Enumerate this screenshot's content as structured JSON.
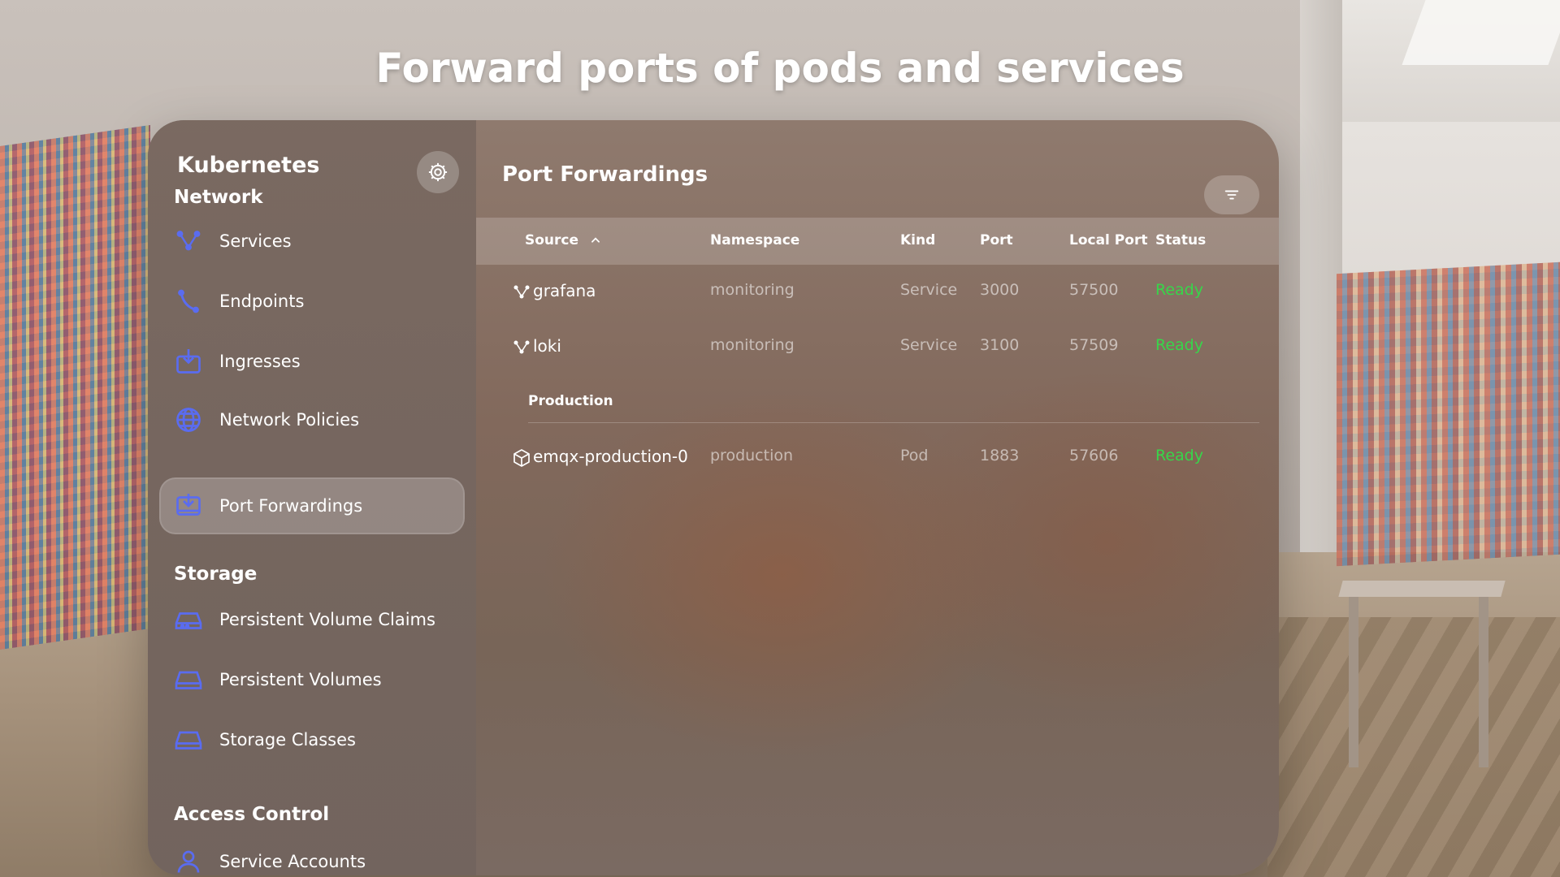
{
  "headline": "Forward ports of pods and services",
  "sidebar": {
    "title": "Kubernetes",
    "settings_icon": "gear-icon",
    "sections": {
      "network": "Network",
      "storage": "Storage",
      "access_control": "Access Control"
    },
    "items": [
      {
        "label": "Services",
        "icon": "services-icon"
      },
      {
        "label": "Endpoints",
        "icon": "endpoints-icon"
      },
      {
        "label": "Ingresses",
        "icon": "ingresses-icon"
      },
      {
        "label": "Network Policies",
        "icon": "globe-icon"
      },
      {
        "label": "Port Forwardings",
        "icon": "port-forward-icon",
        "active": true
      },
      {
        "label": "Persistent Volume Claims",
        "icon": "volume-claim-icon"
      },
      {
        "label": "Persistent Volumes",
        "icon": "drive-icon"
      },
      {
        "label": "Storage Classes",
        "icon": "drive-icon"
      },
      {
        "label": "Service Accounts",
        "icon": "person-icon"
      }
    ]
  },
  "main": {
    "title": "Port Forwardings",
    "filter_icon": "filter-icon",
    "columns": {
      "source": "Source",
      "namespace": "Namespace",
      "kind": "Kind",
      "port": "Port",
      "local_port": "Local Port",
      "status": "Status"
    },
    "sort": {
      "column": "Source",
      "direction": "ascending",
      "icon": "chevron-up-icon"
    },
    "rows": [
      {
        "source": "grafana",
        "namespace": "monitoring",
        "kind": "Service",
        "port": "3000",
        "local_port": "57500",
        "status": "Ready",
        "icon": "service-icon"
      },
      {
        "source": "loki",
        "namespace": "monitoring",
        "kind": "Service",
        "port": "3100",
        "local_port": "57509",
        "status": "Ready",
        "icon": "service-icon"
      }
    ],
    "groups": [
      {
        "label": "Production",
        "rows": [
          {
            "source": "emqx-production-0",
            "namespace": "production",
            "kind": "Pod",
            "port": "1883",
            "local_port": "57606",
            "status": "Ready",
            "icon": "pod-cube-icon"
          }
        ]
      }
    ]
  },
  "colors": {
    "accent": "#5a6cf0",
    "status_ready": "#37d64a",
    "window_tint": "#82695c"
  }
}
